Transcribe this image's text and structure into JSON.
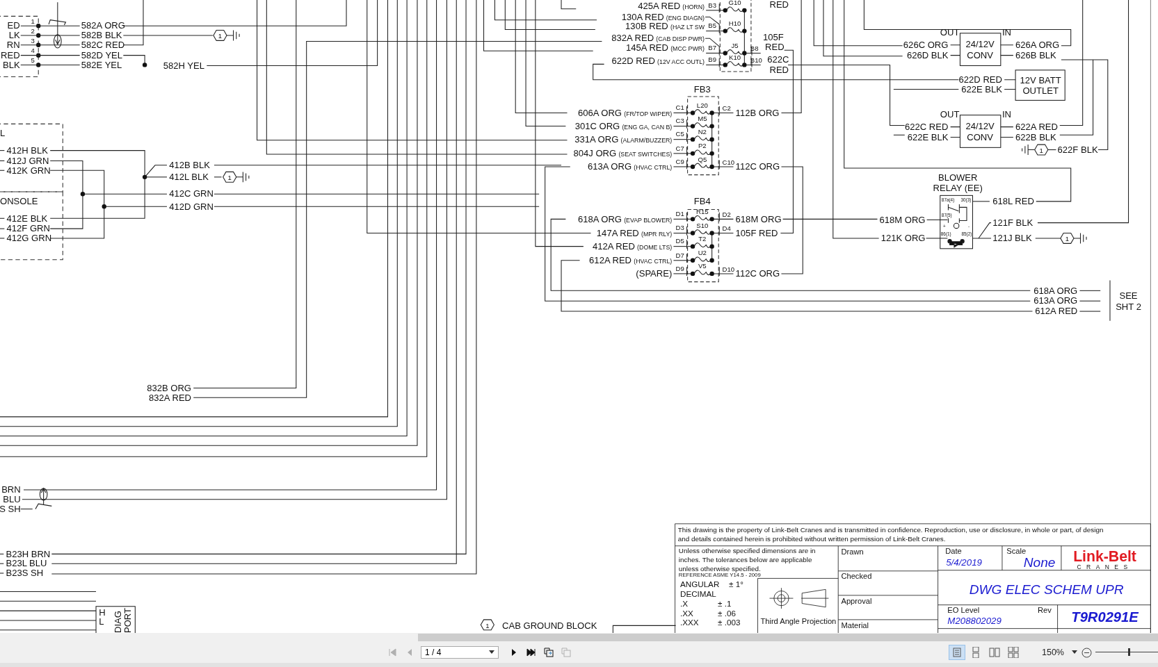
{
  "connector": {
    "pins": [
      {
        "number": "1",
        "end_label": "ED",
        "wire": "582A ORG"
      },
      {
        "number": "2",
        "end_label": "LK",
        "wire": "582B BLK"
      },
      {
        "number": "3",
        "end_label": "RN",
        "wire": "582C RED"
      },
      {
        "number": "4",
        "end_label": "RED",
        "wire": "582D YEL"
      },
      {
        "number": "5",
        "end_label": "BLK",
        "wire": "582E YEL"
      }
    ],
    "splice_wire": "582H YEL",
    "ground_ref": "1"
  },
  "panels": [
    {
      "title": "L",
      "wires": [
        "412H BLK",
        "412J GRN",
        "412K GRN"
      ]
    },
    {
      "title": "ONSOLE",
      "wires": [
        "412E BLK",
        "412F GRN",
        "412G GRN"
      ]
    }
  ],
  "splice": {
    "wires": [
      "412B BLK",
      "412L BLK",
      "412C GRN",
      "412D GRN"
    ],
    "ground_ref": "1"
  },
  "fuse_blocks": [
    {
      "upper_wire_label": "RED",
      "rows": [
        {
          "inputs": [
            {
              "wire": "425A RED",
              "note": "(HORN)"
            }
          ],
          "in_pin": "B3",
          "fuse": "G10"
        },
        {
          "inputs": [
            {
              "wire": "130A RED",
              "note": "(ENG DIAGN)"
            },
            {
              "wire": "130B RED",
              "note": "(HAZ LT SW"
            }
          ],
          "in_pin": "B5",
          "fuse": "H10"
        },
        {
          "inputs": [
            {
              "wire": "832A RED",
              "note": "(CAB DISP PWR)"
            },
            {
              "wire": "145A RED",
              "note": "(MCC PWR)"
            }
          ],
          "in_pin": "B7",
          "fuse": "J5",
          "out_pin": "B8",
          "out_wire": [
            "105F",
            "RED"
          ]
        },
        {
          "inputs": [
            {
              "wire": "622D RED",
              "note": "(12V ACC OUTL)"
            }
          ],
          "in_pin": "B9",
          "fuse": "K10",
          "out_pin": "B10",
          "out_wire": [
            "622C",
            "RED"
          ]
        }
      ]
    },
    {
      "title": "FB3",
      "rows": [
        {
          "inputs": [
            {
              "wire": "606A ORG",
              "note": "(FR/TOP WIPER)"
            }
          ],
          "in_pin": "C1",
          "fuse": "L20",
          "out_pin": "C2",
          "out_wire": [
            "112B ORG"
          ]
        },
        {
          "inputs": [
            {
              "wire": "301C ORG",
              "note": "(ENG GA, CAN B)"
            }
          ],
          "in_pin": "C3",
          "fuse": "M5"
        },
        {
          "inputs": [
            {
              "wire": "331A ORG",
              "note": "(ALARM/BUZZER)"
            }
          ],
          "in_pin": "C5",
          "fuse": "N2"
        },
        {
          "inputs": [
            {
              "wire": "804J ORG",
              "note": "(SEAT SWITCHES)"
            }
          ],
          "in_pin": "C7",
          "fuse": "P2"
        },
        {
          "inputs": [
            {
              "wire": "613A ORG",
              "note": "(HVAC CTRL)"
            }
          ],
          "in_pin": "C9",
          "fuse": "Q5",
          "out_pin": "C10",
          "out_wire": [
            "112C ORG"
          ]
        }
      ]
    },
    {
      "title": "FB4",
      "rows": [
        {
          "inputs": [
            {
              "wire": "618A ORG",
              "note": "(EVAP BLOWER)"
            }
          ],
          "in_pin": "D1",
          "fuse": "R15",
          "out_pin": "D2",
          "out_wire": [
            "618M ORG"
          ]
        },
        {
          "inputs": [
            {
              "wire": "147A RED",
              "note": "(MPR RLY)"
            }
          ],
          "in_pin": "D3",
          "fuse": "S10",
          "out_pin": "D4",
          "out_wire": [
            "105F RED"
          ]
        },
        {
          "inputs": [
            {
              "wire": "412A RED",
              "note": "(DOME LTS)"
            }
          ],
          "in_pin": "D5",
          "fuse": "T2"
        },
        {
          "inputs": [
            {
              "wire": "612A RED",
              "note": "(HVAC CTRL)"
            }
          ],
          "in_pin": "D7",
          "fuse": "U2"
        },
        {
          "inputs": [
            {
              "wire": "(SPARE)"
            }
          ],
          "in_pin": "D9",
          "fuse": "V5",
          "out_pin": "D10",
          "out_wire": [
            "112C ORG"
          ]
        }
      ]
    }
  ],
  "converters": [
    {
      "title": [
        "24/12V",
        "CONV"
      ],
      "out_label": "OUT",
      "in_label": "IN",
      "out_wires": [
        "626C ORG",
        "626D BLK"
      ],
      "in_wires": [
        "626A ORG",
        "626B BLK"
      ]
    },
    {
      "title": [
        "24/12V",
        "CONV"
      ],
      "out_label": "OUT",
      "in_label": "IN",
      "out_wires": [
        "622C RED",
        "622E BLK"
      ],
      "in_wires": [
        "622A RED",
        "622B BLK"
      ],
      "ground": {
        "ref": "1",
        "wire": "622F BLK"
      }
    }
  ],
  "battery_outlet": {
    "title": [
      "12V BATT",
      "OUTLET"
    ],
    "wires": [
      "622D RED",
      "622E BLK"
    ]
  },
  "blower_relay": {
    "title": [
      "BLOWER",
      "RELAY (EE)"
    ],
    "terminals": [
      "87a(4)",
      "30(3)",
      "87(5)",
      "+",
      "-",
      "86(1)",
      "85(2)"
    ],
    "wires_left": [
      "618M ORG",
      "121K ORG"
    ],
    "wires_right": [
      "618L RED",
      "121F BLK",
      "121J BLK"
    ],
    "ground_ref": "1"
  },
  "sheet_ref": {
    "wires": [
      "618A ORG",
      "613A ORG",
      "612A RED"
    ],
    "note": [
      "SEE",
      "SHT 2"
    ]
  },
  "mid_wires": [
    "832B ORG",
    "832A RED"
  ],
  "can_upper": [
    "BRN",
    "BLU",
    "S SH"
  ],
  "can_lower": [
    "B23H BRN",
    "B23L BLU",
    "B23S SH"
  ],
  "diag_port": {
    "pins": [
      "H",
      "L"
    ],
    "title": [
      "DIAG",
      "PORT"
    ]
  },
  "legend": {
    "ref": "1",
    "text": "CAB GROUND BLOCK"
  },
  "title_block": {
    "notice": [
      "This drawing is the property of Link-Belt Cranes and is transmitted in confidence. Reproduction, use or disclosure, in whole or part, of design",
      "and details contained herein is prohibited without written permission of Link-Belt Cranes."
    ],
    "tolerance_note": [
      "Unless otherwise specified dimensions are in",
      "inches.  The tolerances below are applicable",
      "unless otherwise specified."
    ],
    "reference": "REFERENCE ASME Y14.5 - 2009",
    "angular": {
      "label": "ANGULAR",
      "value": "± 1°"
    },
    "decimal_label": "DECIMAL",
    "decimals": [
      {
        "label": ".X",
        "value": "± .1"
      },
      {
        "label": ".XX",
        "value": "± .06"
      },
      {
        "label": ".XXX",
        "value": "± .003"
      }
    ],
    "projection": "Third Angle Projection",
    "signoffs": [
      "Drawn",
      "Checked",
      "Approval",
      "Material"
    ],
    "date": {
      "label": "Date",
      "value": "5/4/2019"
    },
    "scale": {
      "label": "Scale",
      "value": "None"
    },
    "logo": {
      "name": "Link-Belt",
      "tagline": "CRANES"
    },
    "drawing_title": "DWG ELEC SCHEM UPR",
    "eo_level": {
      "label": "EO Level",
      "value": "M208802029"
    },
    "rev": {
      "label": "Rev",
      "value": "T9R0291E"
    }
  },
  "viewer": {
    "nav_back": [
      {
        "kind": "first",
        "disabled": true
      },
      {
        "kind": "prev",
        "disabled": true
      }
    ],
    "page": "1 / 4",
    "nav_forward": [
      {
        "kind": "next",
        "disabled": false
      },
      {
        "kind": "last",
        "disabled": false
      }
    ],
    "tools": [
      {
        "kind": "extract",
        "disabled": false
      },
      {
        "kind": "insert",
        "disabled": true
      }
    ],
    "view_modes": [
      {
        "kind": "single",
        "selected": true
      },
      {
        "kind": "continuous",
        "selected": false
      },
      {
        "kind": "facing",
        "selected": false
      },
      {
        "kind": "facing_continuous",
        "selected": false
      }
    ],
    "zoom": "150%",
    "zoom_slider": {
      "level": 0.53
    }
  }
}
